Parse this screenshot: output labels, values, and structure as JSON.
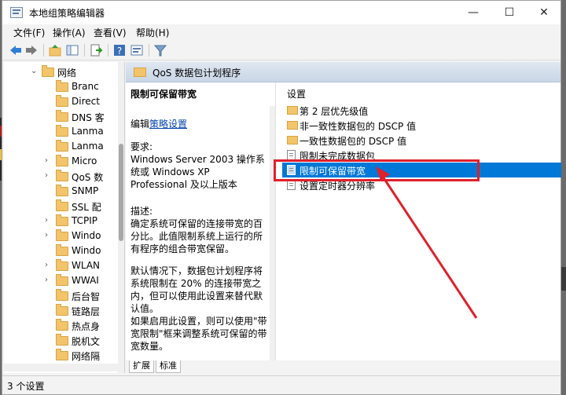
{
  "window": {
    "title": "本地组策略编辑器",
    "min_glyph": "—",
    "max_glyph": "☐",
    "close_glyph": "✕"
  },
  "menu": [
    "文件(F)",
    "操作(A)",
    "查看(V)",
    "帮助(H)"
  ],
  "tree": {
    "items": [
      {
        "label": "网络",
        "expand": "⌄"
      },
      {
        "label": "Branc",
        "expand": ""
      },
      {
        "label": "Direct",
        "expand": ""
      },
      {
        "label": "DNS 客",
        "expand": ""
      },
      {
        "label": "Lanma",
        "expand": ""
      },
      {
        "label": "Lanma",
        "expand": ""
      },
      {
        "label": "Micro",
        "expand": "›"
      },
      {
        "label": "QoS 数",
        "expand": "›"
      },
      {
        "label": "SNMP",
        "expand": ""
      },
      {
        "label": "SSL 配",
        "expand": ""
      },
      {
        "label": "TCPIP",
        "expand": "›"
      },
      {
        "label": "Windo",
        "expand": "›"
      },
      {
        "label": "Windo",
        "expand": ""
      },
      {
        "label": "WLAN",
        "expand": "›"
      },
      {
        "label": "WWAI",
        "expand": "›"
      },
      {
        "label": "后台智",
        "expand": ""
      },
      {
        "label": "链路层",
        "expand": ""
      },
      {
        "label": "热点身",
        "expand": ""
      },
      {
        "label": "脱机文",
        "expand": ""
      },
      {
        "label": "网络隔",
        "expand": ""
      }
    ]
  },
  "pane": {
    "header": "QoS 数据包计划程序",
    "desc_title": "限制可保留带宽",
    "edit_prefix": "编辑",
    "edit_link": "策略设置",
    "req_label": "要求:",
    "req_text": "Windows Server 2003 操作系统或 Windows XP Professional 及以上版本",
    "desc_label": "描述:",
    "desc_text": "确定系统可保留的连接带宽的百分比。此值限制系统上运行的所有程序的组合带宽保留。",
    "default_text": "默认情况下，数据包计划程序将系统限制在 20% 的连接带宽之内，但可以使用此设置来替代默认值。",
    "if_text": "如果启用此设置，则可以使用\"带宽限制\"框来调整系统可保留的带宽数量。"
  },
  "settings": {
    "header": "设置",
    "items": [
      {
        "label": "第 2 层优先级值",
        "type": "folder"
      },
      {
        "label": "非一致性数据包的 DSCP 值",
        "type": "folder"
      },
      {
        "label": "一致性数据包的 DSCP 值",
        "type": "folder"
      },
      {
        "label": "限制未完成数据包",
        "type": "doc"
      },
      {
        "label": "限制可保留带宽",
        "type": "doc"
      },
      {
        "label": "设置定时器分辨率",
        "type": "doc"
      }
    ]
  },
  "tabs": [
    "扩展",
    "标准"
  ],
  "status": "3 个设置",
  "colors": {
    "selection": "#0078d7",
    "annotation": "#e0202a"
  }
}
